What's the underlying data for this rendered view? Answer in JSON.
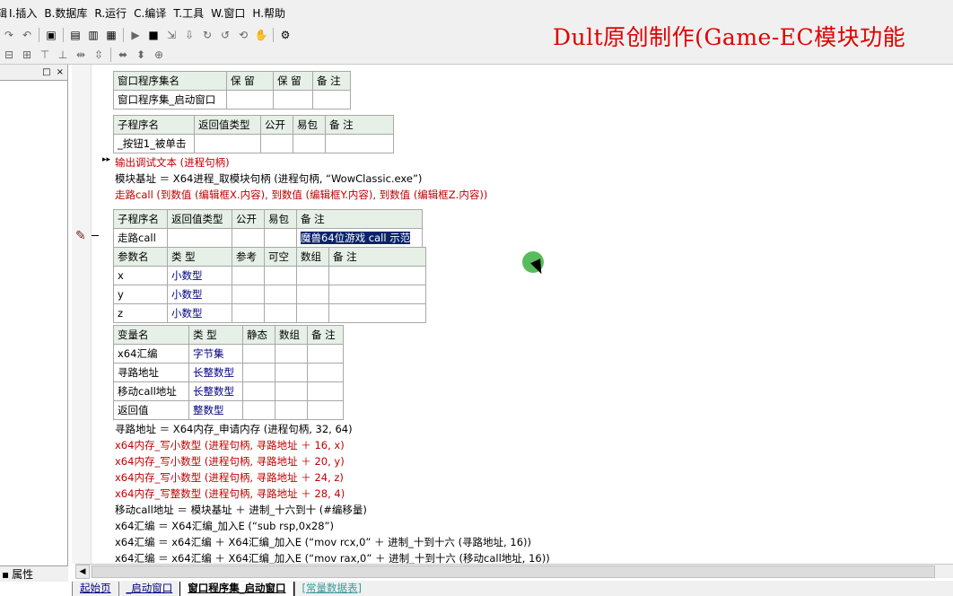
{
  "menu": [
    {
      "label": "E.编辑"
    },
    {
      "label": "I.插入"
    },
    {
      "label": "B.数据库"
    },
    {
      "label": "R.运行"
    },
    {
      "label": "C.编译"
    },
    {
      "label": "T.工具"
    },
    {
      "label": "W.窗口"
    },
    {
      "label": "H.帮助"
    }
  ],
  "banner": "Dult原创制作(Game-EC模块功能",
  "left_panel": {
    "bottom_label": "属性",
    "head_buttons": [
      "□",
      "×"
    ]
  },
  "table_program_set": {
    "headers": [
      "窗口程序集名",
      "保 留",
      "保 留",
      "备 注"
    ],
    "row": [
      "窗口程序集_启动窗口",
      "",
      "",
      ""
    ]
  },
  "table_sub1": {
    "headers": [
      "子程序名",
      "返回值类型",
      "公开",
      "易包",
      "备 注"
    ],
    "row": [
      "_按钮1_被单击",
      "",
      "",
      "",
      ""
    ]
  },
  "code_lines_top": [
    "输出调试文本 (进程句柄)",
    "模块基址 ＝ X64进程_取模块句柄 (进程句柄, “WowClassic.exe”)",
    "走路call (到数值 (编辑框X.内容), 到数值 (编辑框Y.内容), 到数值 (编辑框Z.内容))"
  ],
  "table_sub2": {
    "headers": [
      "子程序名",
      "返回值类型",
      "公开",
      "易包",
      "备 注"
    ],
    "row": [
      "走路call",
      "",
      "",
      "",
      "魔兽64位游戏 call 示范"
    ]
  },
  "table_params": {
    "headers": [
      "参数名",
      "类 型",
      "参考",
      "可空",
      "数组",
      "备 注"
    ],
    "rows": [
      [
        "x",
        "小数型",
        "",
        "",
        "",
        ""
      ],
      [
        "y",
        "小数型",
        "",
        "",
        "",
        ""
      ],
      [
        "z",
        "小数型",
        "",
        "",
        "",
        ""
      ]
    ]
  },
  "table_vars": {
    "headers": [
      "变量名",
      "类 型",
      "静态",
      "数组",
      "备 注"
    ],
    "rows": [
      [
        "x64汇编",
        "字节集",
        "",
        "",
        ""
      ],
      [
        "寻路地址",
        "长整数型",
        "",
        "",
        ""
      ],
      [
        "移动call地址",
        "长整数型",
        "",
        "",
        ""
      ],
      [
        "返回值",
        "整数型",
        "",
        "",
        ""
      ]
    ]
  },
  "code_lines_bottom": [
    "寻路地址 ＝ X64内存_申请内存 (进程句柄, 32, 64)",
    "x64内存_写小数型 (进程句柄, 寻路地址 ＋ 16, x)",
    "x64内存_写小数型 (进程句柄, 寻路地址 ＋ 20, y)",
    "x64内存_写小数型 (进程句柄, 寻路地址 ＋ 24, z)",
    "x64内存_写整数型 (进程句柄, 寻路地址 ＋ 28, 4)",
    "移动call地址 ＝ 模块基址 ＋ 进制_十六到十 (#编移量)",
    "x64汇编 ＝ X64汇编_加入E (“sub rsp,0x28”)",
    "x64汇编 ＝ x64汇编 ＋ X64汇编_加入E (“mov rcx,0” ＋ 进制_十到十六 (寻路地址, 16))",
    "x64汇编 ＝ x64汇编 ＋ X64汇编_加入E (“mov rax,0” ＋ 进制_十到十六 (移动call地址, 16))"
  ],
  "tabs": [
    {
      "label": "起始页"
    },
    {
      "label": "_启动窗口"
    },
    {
      "label": "窗口程序集_启动窗口"
    },
    {
      "label": "[常量数据表]"
    }
  ],
  "colors": {
    "function_red": "#c00000",
    "type_blue": "#000080",
    "selection": "#0a246a",
    "banner_red": "#e00000"
  }
}
